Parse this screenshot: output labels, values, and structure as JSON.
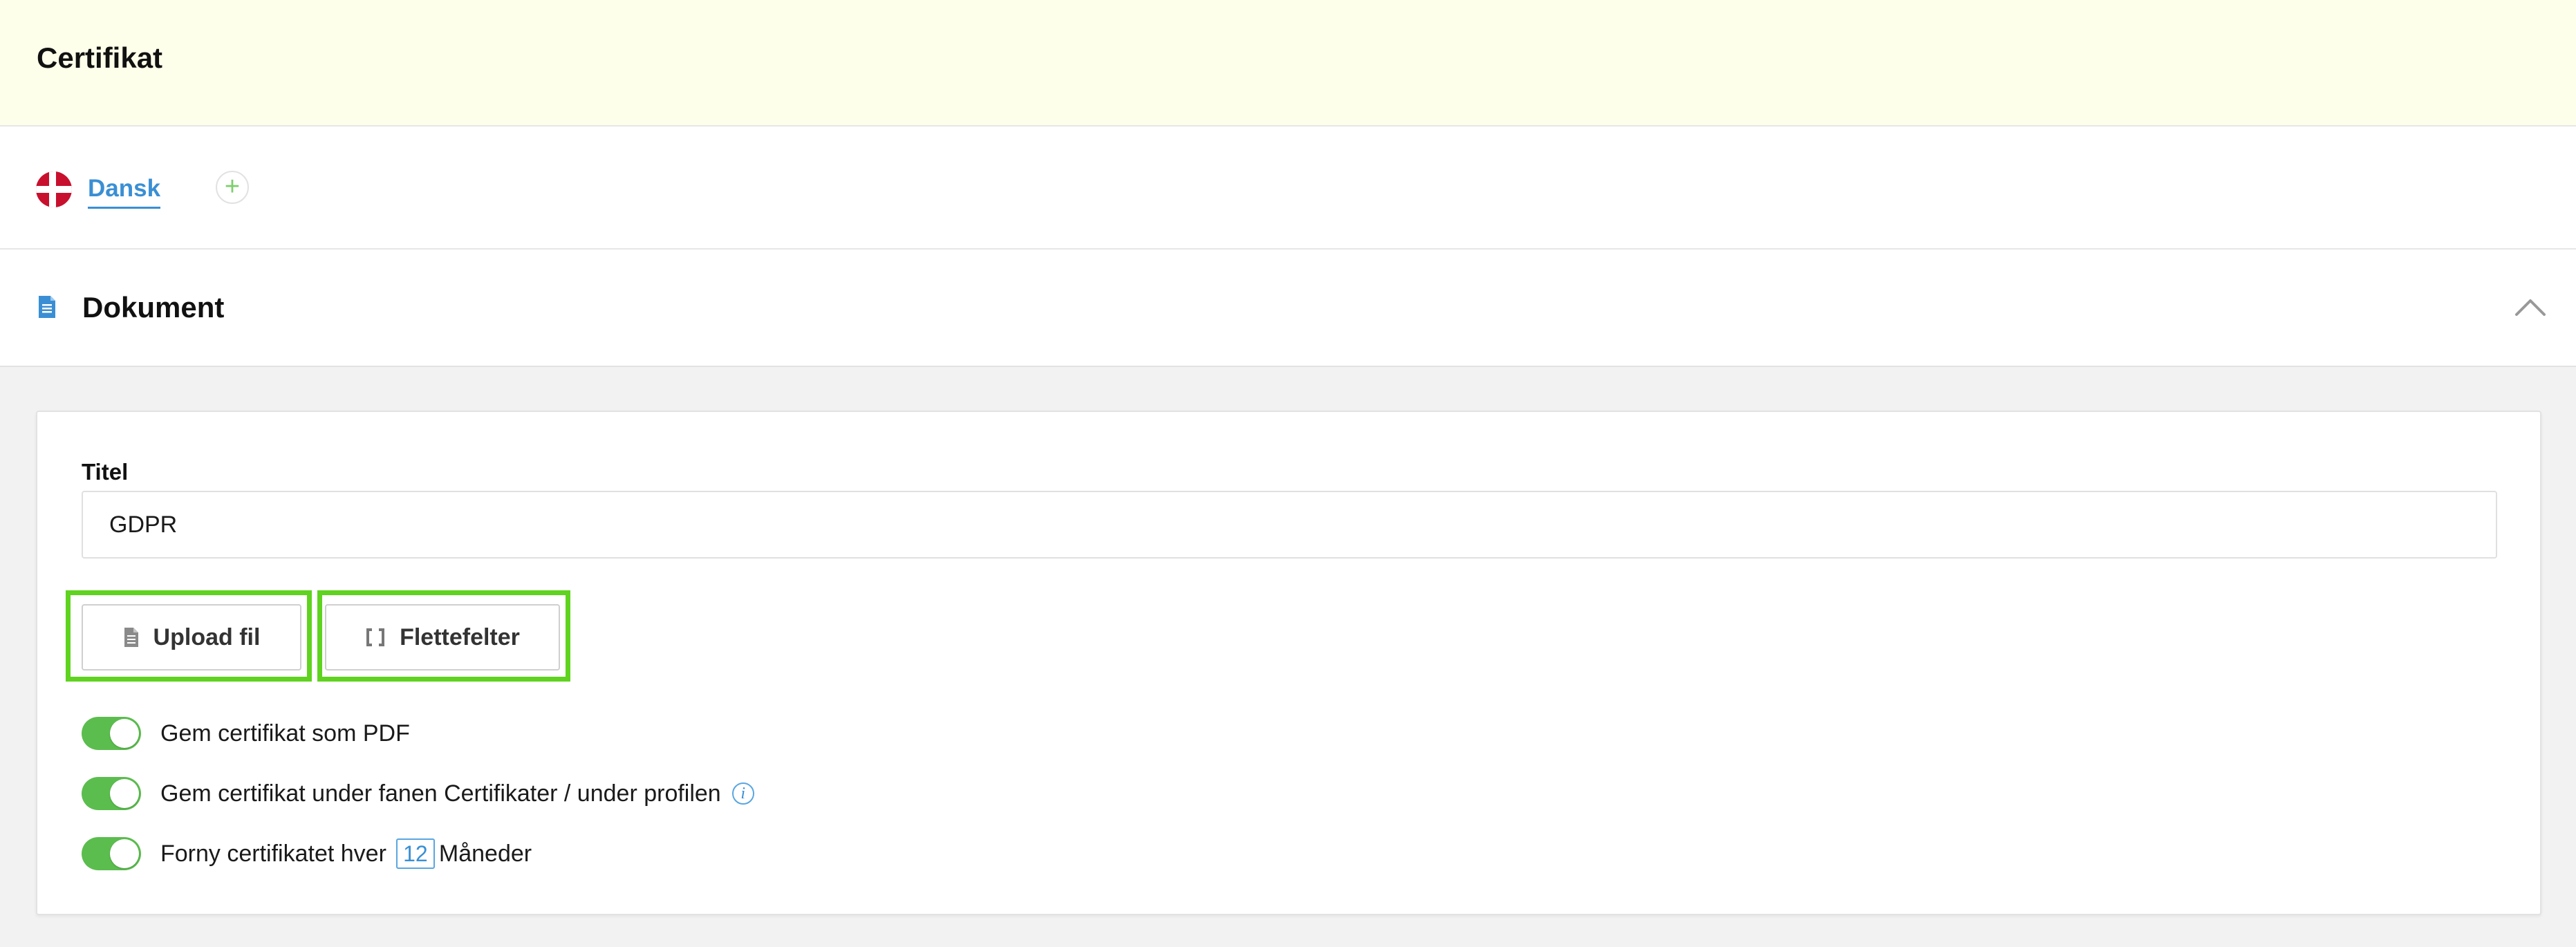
{
  "header": {
    "title": "Certifikat"
  },
  "languages": {
    "active": "Dansk",
    "add_symbol": "+"
  },
  "document_section": {
    "title": "Dokument"
  },
  "form": {
    "title_label": "Titel",
    "title_value": "GDPR",
    "upload_button": "Upload fil",
    "merge_fields_button": "Flettefelter",
    "toggles": [
      {
        "label": "Gem certifikat som PDF",
        "on": true
      },
      {
        "label": "Gem certifikat under fanen Certifikater / under profilen",
        "on": true
      },
      {
        "label": "Forny certifikatet hver",
        "on": true
      }
    ],
    "renew_months_value": "12",
    "renew_months_suffix": "Måneder",
    "info_symbol": "i"
  },
  "colors": {
    "header_bg": "#feffea",
    "link": "#3a8fd4",
    "toggle_on": "#5bbd4e",
    "highlight": "#5fd31f",
    "flag_red": "#c8102e"
  }
}
